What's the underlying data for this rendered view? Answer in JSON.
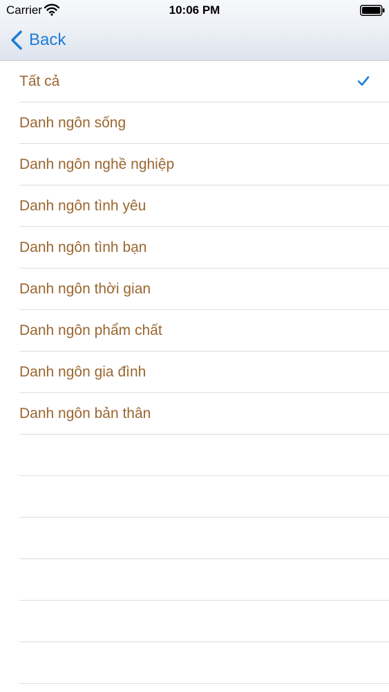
{
  "status_bar": {
    "carrier": "Carrier",
    "time": "10:06 PM",
    "icons": [
      "wifi-icon",
      "battery-icon"
    ]
  },
  "nav_bar": {
    "back_label": "Back",
    "back_icon": "chevron-left-icon"
  },
  "categories": [
    {
      "label": "Tất cả",
      "selected": true
    },
    {
      "label": "Danh ngôn sống",
      "selected": false
    },
    {
      "label": "Danh ngôn nghề nghiệp",
      "selected": false
    },
    {
      "label": "Danh ngôn tình yêu",
      "selected": false
    },
    {
      "label": "Danh ngôn tình bạn",
      "selected": false
    },
    {
      "label": "Danh ngôn thời gian",
      "selected": false
    },
    {
      "label": "Danh ngôn phẩm chất",
      "selected": false
    },
    {
      "label": "Danh ngôn gia đình",
      "selected": false
    },
    {
      "label": "Danh ngôn bản thân",
      "selected": false
    }
  ],
  "colors": {
    "accent": "#1c7cd5",
    "item_text": "#9a6630",
    "separator": "#dadde1"
  }
}
